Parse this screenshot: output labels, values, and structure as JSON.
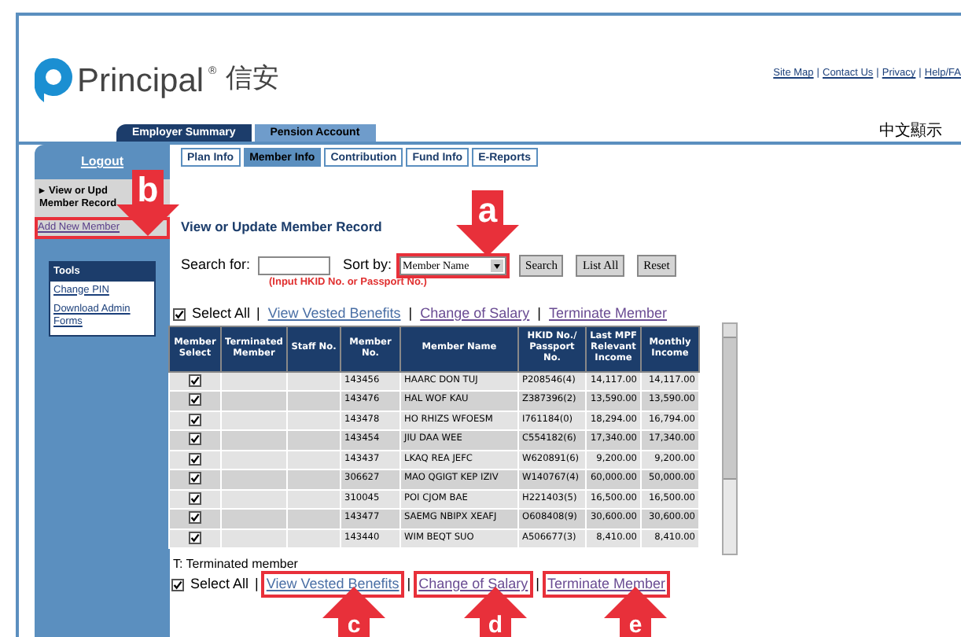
{
  "logo": {
    "name": "Principal",
    "mark": "®",
    "chinese": "信安"
  },
  "top_links": [
    "Site Map",
    "Contact Us",
    "Privacy",
    "Help/FA"
  ],
  "separator": "|",
  "language_link": "中文顯示",
  "main_tabs": [
    {
      "label": "Employer Summary",
      "selected": false
    },
    {
      "label": "Pension Account",
      "selected": true
    }
  ],
  "sub_tabs": [
    {
      "label": "Plan Info",
      "selected": false
    },
    {
      "label": "Member Info",
      "selected": true
    },
    {
      "label": "Contribution",
      "selected": false
    },
    {
      "label": "Fund Info",
      "selected": false
    },
    {
      "label": "E-Reports",
      "selected": false
    }
  ],
  "sidebar": {
    "logout": "Logout",
    "current_marker": "▸",
    "current_lines": [
      "View or Upd",
      "Member Record"
    ],
    "add_link": {
      "label": "Add New Member",
      "highlighted": true
    },
    "tools": {
      "title": "Tools",
      "links": [
        "Change PIN",
        "Download Admin Forms"
      ]
    }
  },
  "page_title": "View or Update Member Record",
  "search": {
    "label": "Search for:",
    "sort_label": "Sort by:",
    "sort_value": "Member Name",
    "sort_highlighted": true,
    "hint": "(Input HKID No. or Passport No.)",
    "buttons": [
      "Search",
      "List All",
      "Reset"
    ]
  },
  "top_actions": {
    "select_all": {
      "label": "Select All",
      "checked": true
    },
    "links": [
      {
        "label": "View Vested Benefits",
        "highlighted": false
      },
      {
        "label": "Change of Salary",
        "highlighted": false
      },
      {
        "label": "Terminate Member",
        "highlighted": false
      }
    ]
  },
  "table": {
    "columns": [
      "Member Select",
      "Terminated Member",
      "Staff No.",
      "Member No.",
      "Member Name",
      "HKID No./ Passport No.",
      "Last MPF Relevant Income",
      "Monthly Income"
    ],
    "rows": [
      {
        "selected": true,
        "member_no": "143456",
        "name": "HAARC DON TUJ",
        "hkid": "P208546(4)",
        "last_income": "14,117.00",
        "monthly": "14,117.00"
      },
      {
        "selected": true,
        "member_no": "143476",
        "name": "HAL WOF KAU",
        "hkid": "Z387396(2)",
        "last_income": "13,590.00",
        "monthly": "13,590.00"
      },
      {
        "selected": true,
        "member_no": "143478",
        "name": "HO RHIZS WFOESM",
        "hkid": "I761184(0)",
        "last_income": "18,294.00",
        "monthly": "16,794.00"
      },
      {
        "selected": true,
        "member_no": "143454",
        "name": "JIU DAA WEE",
        "hkid": "C554182(6)",
        "last_income": "17,340.00",
        "monthly": "17,340.00"
      },
      {
        "selected": true,
        "member_no": "143437",
        "name": "LKAQ REA JEFC",
        "hkid": "W620891(6)",
        "last_income": "9,200.00",
        "monthly": "9,200.00"
      },
      {
        "selected": true,
        "member_no": "306627",
        "name": "MAO QGIGT KEP IZIV",
        "hkid": "W140767(4)",
        "last_income": "60,000.00",
        "monthly": "50,000.00"
      },
      {
        "selected": true,
        "member_no": "310045",
        "name": "POI CJOM BAE",
        "hkid": "H221403(5)",
        "last_income": "16,500.00",
        "monthly": "16,500.00"
      },
      {
        "selected": true,
        "member_no": "143477",
        "name": "SAEMG NBIPX XEAFJ",
        "hkid": "O608408(9)",
        "last_income": "30,600.00",
        "monthly": "30,600.00"
      },
      {
        "selected": true,
        "member_no": "143440",
        "name": "WIM BEQT SUO",
        "hkid": "A506677(3)",
        "last_income": "8,410.00",
        "monthly": "8,410.00"
      }
    ]
  },
  "legend": "T: Terminated member",
  "bottom_actions": {
    "select_all": {
      "label": "Select All",
      "checked": true
    },
    "links": [
      {
        "label": "View Vested Benefits",
        "highlighted": true
      },
      {
        "label": "Change of Salary",
        "highlighted": true
      },
      {
        "label": "Terminate Member",
        "highlighted": true
      }
    ]
  },
  "callouts": [
    {
      "letter": "a",
      "kind": "down"
    },
    {
      "letter": "b",
      "kind": "down"
    },
    {
      "letter": "c",
      "kind": "up"
    },
    {
      "letter": "d",
      "kind": "up"
    },
    {
      "letter": "e",
      "kind": "up"
    }
  ]
}
